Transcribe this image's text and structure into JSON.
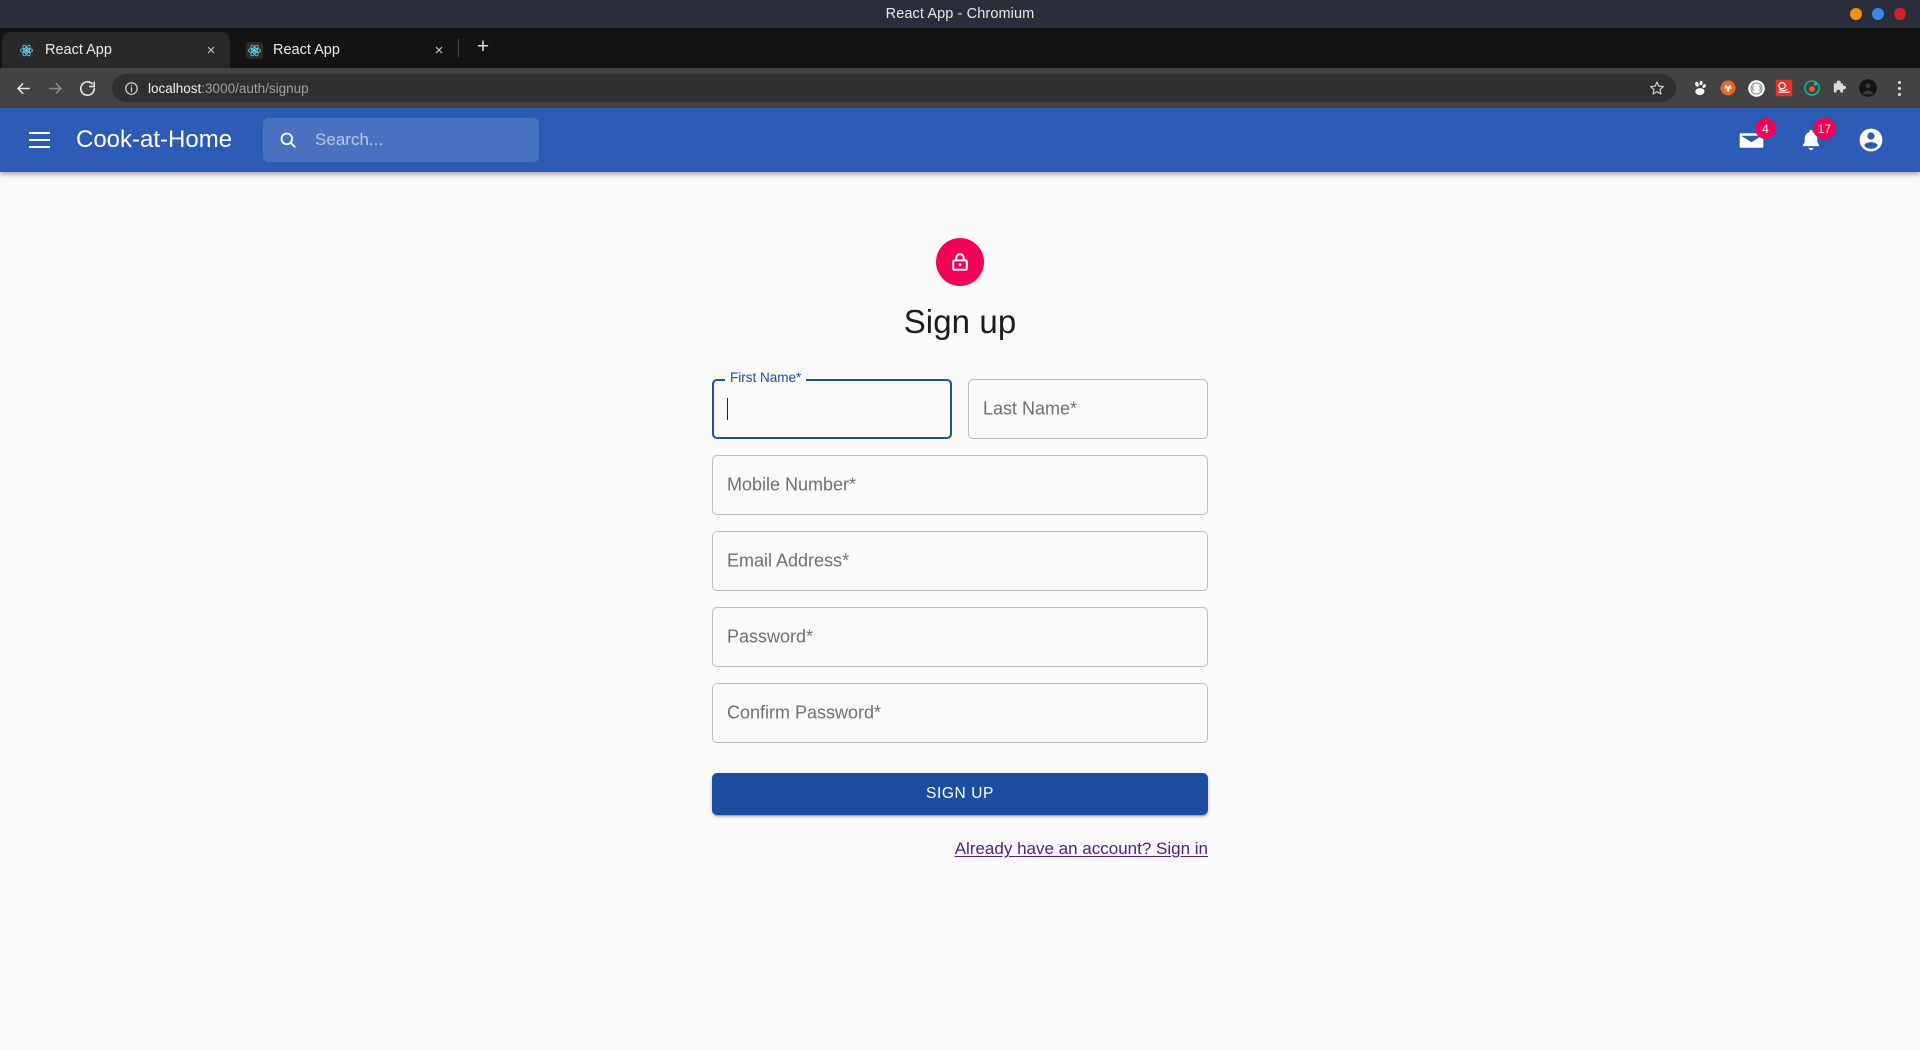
{
  "window": {
    "title": "React App - Chromium",
    "controls": [
      {
        "name": "minimize",
        "color": "#f7900b"
      },
      {
        "name": "maximize",
        "color": "#3b87f0"
      },
      {
        "name": "close",
        "color": "#d42222"
      }
    ]
  },
  "browser": {
    "tabs": [
      {
        "title": "React App",
        "favicon": "react-icon",
        "active": true,
        "close_label": "×"
      },
      {
        "title": "React App",
        "favicon": "react-icon",
        "active": false,
        "close_label": "×"
      }
    ],
    "new_tab_label": "+",
    "nav": {
      "back": "back-arrow-icon",
      "forward": "forward-arrow-icon",
      "reload": "reload-icon"
    },
    "omnibox": {
      "host": "localhost",
      "path": ":3000/auth/signup",
      "info_icon": "info-circle-icon",
      "bookmark_icon": "star-outline-icon"
    },
    "extensions": [
      {
        "name": "gnome-extension-icon",
        "color": "#ffffff"
      },
      {
        "name": "orange-circle-extension-icon",
        "color": "#f26322"
      },
      {
        "name": "white-ring-extension-icon",
        "color": "#ffffff"
      },
      {
        "name": "red-square-extension-icon",
        "color": "#e0332c"
      },
      {
        "name": "green-orbit-extension-icon",
        "color": "#13c296"
      },
      {
        "name": "puzzle-extensions-icon",
        "color": "#d7d9dc"
      },
      {
        "name": "profile-avatar-icon",
        "color": "#1a1a1a"
      }
    ],
    "menu_label": "kebab-menu-icon"
  },
  "appbar": {
    "menu_icon": "hamburger-menu-icon",
    "brand": "Cook-at-Home",
    "search": {
      "icon": "search-icon",
      "placeholder": "Search..."
    },
    "actions": [
      {
        "name": "mail-icon",
        "badge": "4"
      },
      {
        "name": "notifications-bell-icon",
        "badge": "17"
      },
      {
        "name": "account-circle-icon",
        "badge": null
      }
    ],
    "colors": {
      "background": "#2b5bb5",
      "badge": "#f50057"
    }
  },
  "signup": {
    "avatar_icon": "lock-icon",
    "avatar_color": "#f50057",
    "title": "Sign up",
    "fields": [
      {
        "id": "first-name",
        "label": "First Name",
        "required_mark": "*",
        "value": "",
        "focused": true,
        "half": true
      },
      {
        "id": "last-name",
        "label": "Last Name",
        "required_mark": "*",
        "value": "",
        "focused": false,
        "half": true
      },
      {
        "id": "mobile-number",
        "label": "Mobile Number",
        "required_mark": "*",
        "value": "",
        "focused": false,
        "half": false
      },
      {
        "id": "email-address",
        "label": "Email Address",
        "required_mark": "*",
        "value": "",
        "focused": false,
        "half": false
      },
      {
        "id": "password",
        "label": "Password",
        "required_mark": "*",
        "value": "",
        "focused": false,
        "half": false
      },
      {
        "id": "confirm-password",
        "label": "Confirm Password",
        "required_mark": "*",
        "value": "",
        "focused": false,
        "half": false
      }
    ],
    "submit_label": "SIGN UP",
    "signin_link": "Already have an account? Sign in",
    "colors": {
      "primary": "#1c4ea0",
      "link": "#551a8b"
    }
  }
}
